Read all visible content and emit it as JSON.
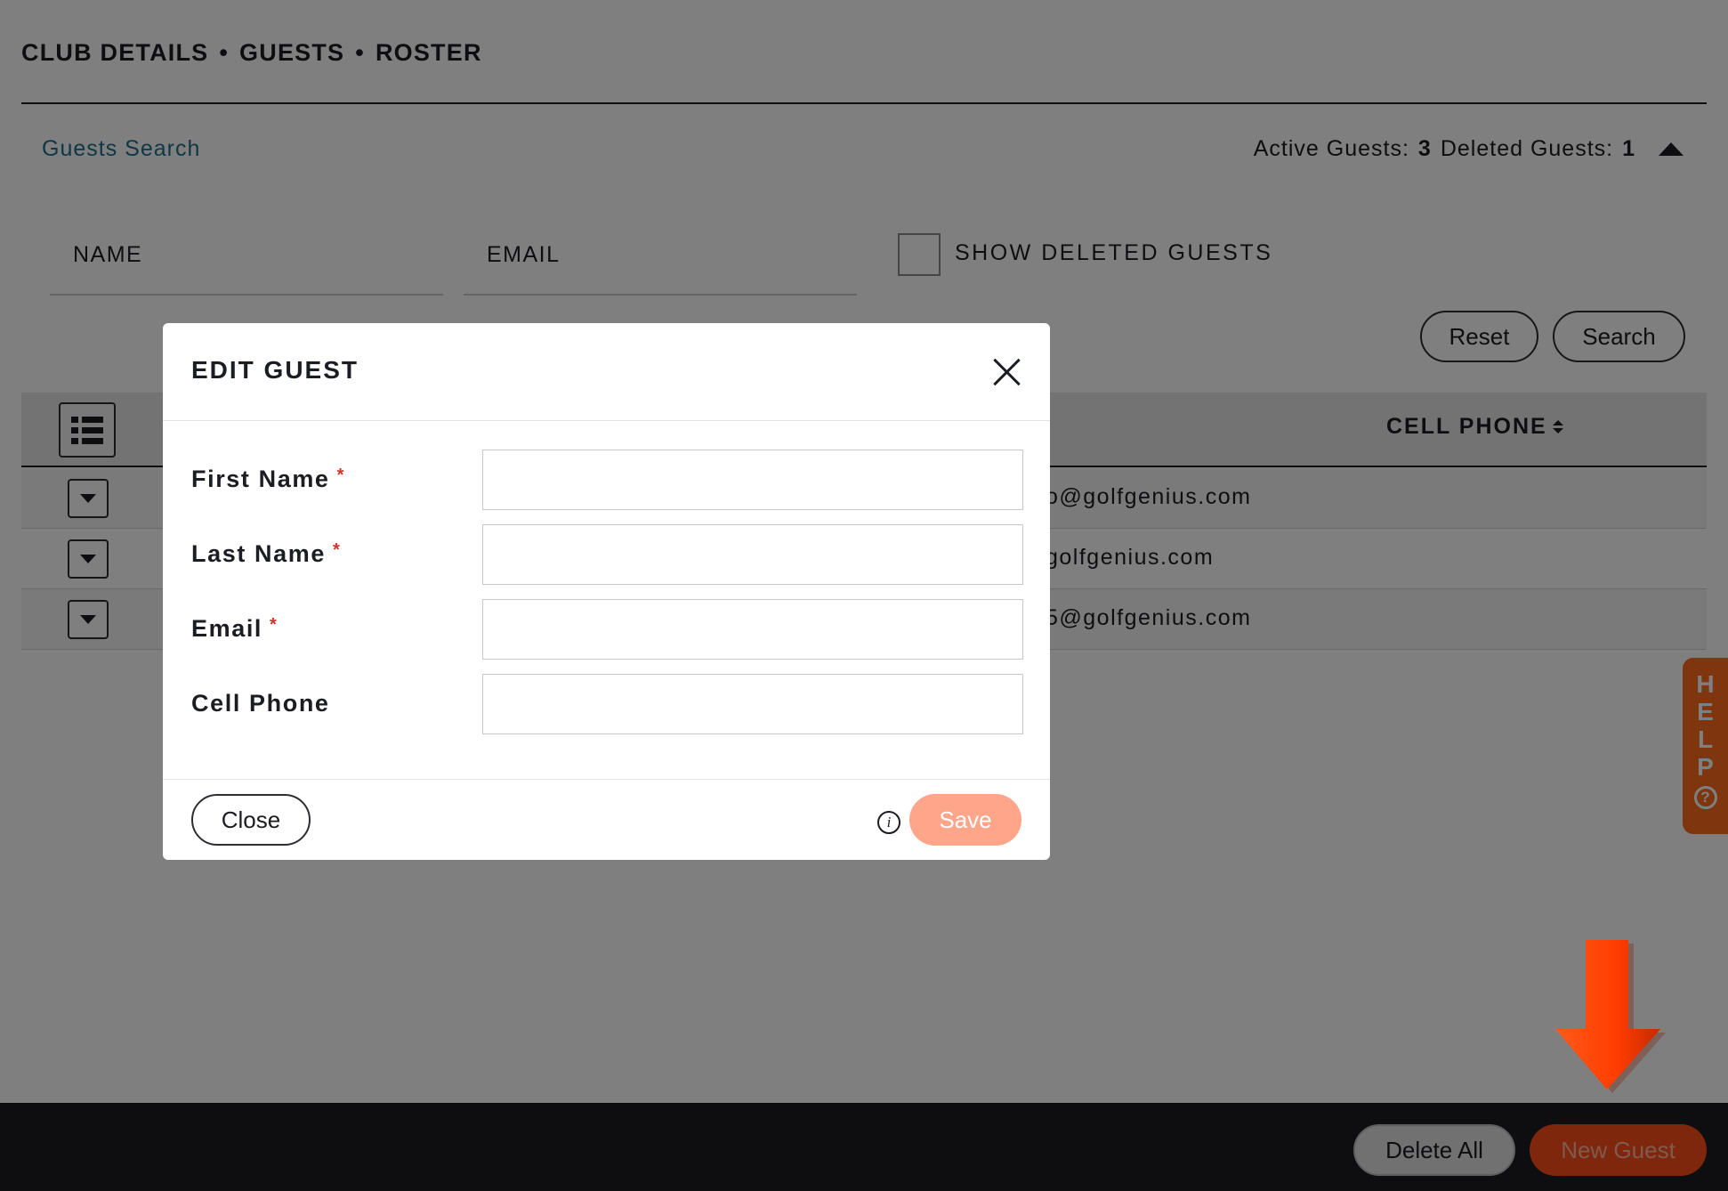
{
  "breadcrumb": [
    "CLUB DETAILS",
    "GUESTS",
    "ROSTER"
  ],
  "breadcrumb_separator": "•",
  "search_panel": {
    "title": "Guests Search",
    "active_label": "Active Guests:",
    "active_count": "3",
    "deleted_label": "Deleted Guests:",
    "deleted_count": "1",
    "name_placeholder": "NAME",
    "email_placeholder": "EMAIL",
    "show_deleted_label": "SHOW DELETED GUESTS",
    "reset_label": "Reset",
    "search_label": "Search"
  },
  "table": {
    "column_cell_phone": "CELL PHONE",
    "rows": [
      {
        "email_fragment": "o@golfgenius.com"
      },
      {
        "email_fragment": "golfgenius.com"
      },
      {
        "email_fragment": "5@golfgenius.com"
      }
    ]
  },
  "help_tab": {
    "letters": [
      "H",
      "E",
      "L",
      "P"
    ],
    "icon": "?"
  },
  "bottom_bar": {
    "delete_all_label": "Delete All",
    "new_guest_label": "New Guest"
  },
  "modal": {
    "title": "EDIT GUEST",
    "fields": [
      {
        "label": "First Name",
        "required": "*",
        "value": ""
      },
      {
        "label": "Last Name",
        "required": "*",
        "value": ""
      },
      {
        "label": "Email",
        "required": "*",
        "value": ""
      },
      {
        "label": "Cell Phone",
        "required": "",
        "value": ""
      }
    ],
    "close_label": "Close",
    "info_glyph": "i",
    "save_label": "Save"
  },
  "colors": {
    "accent_orange": "#ff4e1a",
    "save_disabled": "#ffa58a",
    "link_blue": "#1f6f8b",
    "required_red": "#d93025",
    "dark_bar": "#1c1d22"
  },
  "icons": [
    "collapse-up-icon",
    "list-view-icon",
    "sort-icon",
    "chevron-down-icon",
    "close-icon",
    "info-icon",
    "help-question-icon",
    "arrow-down-icon"
  ]
}
